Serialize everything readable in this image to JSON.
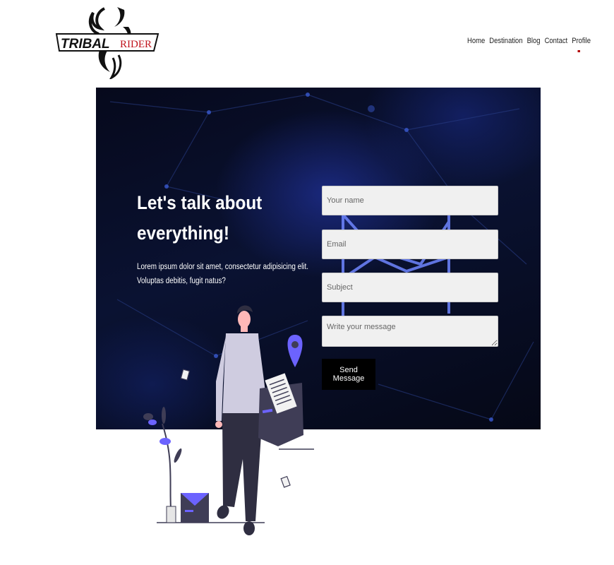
{
  "header": {
    "logo": {
      "text_primary": "TRIBAL",
      "text_secondary": "RIDER"
    },
    "nav": [
      {
        "label": "Home"
      },
      {
        "label": "Destination"
      },
      {
        "label": "Blog"
      },
      {
        "label": "Contact"
      },
      {
        "label": "Profile"
      }
    ]
  },
  "hero": {
    "title_line1": "Let's talk about",
    "title_line2": "everything!",
    "description": "Lorem ipsum dolor sit amet, consectetur adipisicing elit. Voluptas debitis, fugit natus?"
  },
  "form": {
    "name_placeholder": "Your name",
    "email_placeholder": "Email",
    "subject_placeholder": "Subject",
    "message_placeholder": "Write your message",
    "submit_label": "Send Message"
  },
  "colors": {
    "accent": "#6c63ff",
    "button_bg": "#000000",
    "active_indicator": "#b30000",
    "hero_bg": "#0a1232"
  }
}
